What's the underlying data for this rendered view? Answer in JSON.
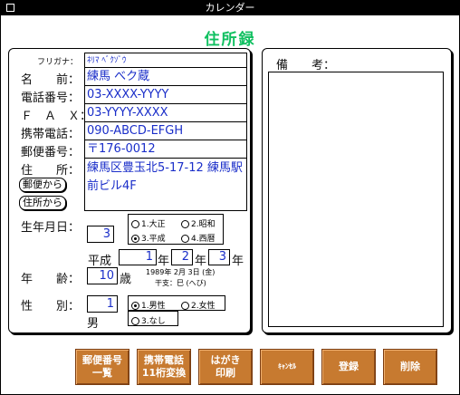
{
  "window": {
    "title": "カレンダー"
  },
  "page_title": "住所録",
  "labels": {
    "furigana": "フリガナ：",
    "name": "名　　前：",
    "phone": "電話番号：",
    "fax": "Ｆ　Ａ　Ｘ：",
    "mobile": "携帯電話：",
    "postal": "郵便番号：",
    "address": "住　　所：",
    "birthdate": "生年月日：",
    "age": "年　　齢：",
    "gender": "性　　別：",
    "notes": "備　　考："
  },
  "fields": {
    "furigana": "ﾈﾘﾏ ﾍﾞｸｿﾞｳ",
    "name": "練馬 べク蔵",
    "phone": "03-XXXX-YYYY",
    "fax": "03-YYYY-XXXX",
    "mobile": "090-ABCD-EFGH",
    "postal": "〒176-0012",
    "address": "練馬区豊玉北5-17-12 練馬駅前ビル4F"
  },
  "address_buttons": {
    "from_postal": "郵便から",
    "from_address": "住所から"
  },
  "birth": {
    "era_code": "3",
    "era_options": [
      "1.大正",
      "2.昭和",
      "3.平成",
      "4.西暦"
    ],
    "era_selected": "3.平成",
    "era_name": "平成",
    "year": "1",
    "year_unit": "年",
    "month": "2",
    "month_unit": "年",
    "day": "3",
    "day_unit": "年",
    "western_date": "1989年 2月 3日 (金)",
    "zodiac": "干支：巳 (へび)"
  },
  "age": {
    "value": "10",
    "unit": "歳"
  },
  "gender": {
    "code": "1",
    "label": "男",
    "options": [
      "1.男性",
      "2.女性",
      "3.なし"
    ],
    "selected": "1.男性"
  },
  "buttons": {
    "postal_list": "郵便番号一覧",
    "postal_list_line1": "郵便番号",
    "postal_list_line2": "一覧",
    "mobile_convert_line1": "携帯電話",
    "mobile_convert_line2": "11桁変換",
    "postcard_line1": "はがき",
    "postcard_line2": "印刷",
    "cancel": "ｷｬﾝｾﾙ",
    "register": "登録",
    "delete": "削除"
  },
  "colors": {
    "accent_title": "#10c060",
    "field_text": "#1a2ec9",
    "button_bg": "#c77a30"
  }
}
